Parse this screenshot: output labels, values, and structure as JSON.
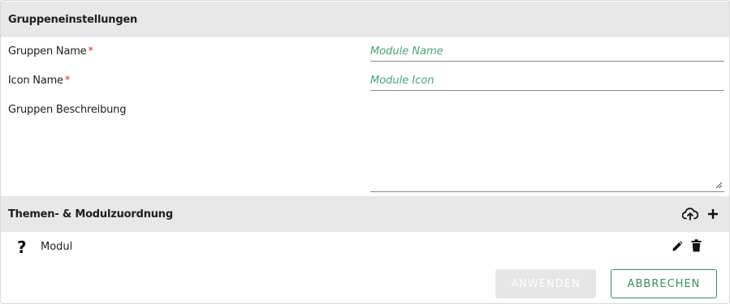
{
  "group_settings": {
    "title": "Gruppeneinstellungen",
    "fields": [
      {
        "label": "Gruppen Name",
        "required_mark": "*",
        "placeholder": "Module Name",
        "value": ""
      },
      {
        "label": "Icon Name",
        "required_mark": "*",
        "placeholder": "Module Icon",
        "value": ""
      }
    ],
    "description": {
      "label": "Gruppen Beschreibung",
      "value": ""
    }
  },
  "assignment": {
    "title": "Themen- & Modulzuordnung",
    "header_icons": [
      "upload-cloud-icon",
      "add-icon"
    ],
    "modules": [
      {
        "icon": "question-mark-icon",
        "icon_glyph": "?",
        "label": "Modul",
        "actions": [
          "edit-icon",
          "delete-icon"
        ]
      }
    ]
  },
  "actions": {
    "apply_label": "ANWENDEN",
    "apply_disabled": true,
    "cancel_label": "ABBRECHEN"
  },
  "colors": {
    "header_bg": "#e8e8e8",
    "accent_green": "#3c8f65",
    "placeholder_green": "#4aa37a",
    "required_red": "#d32f2f",
    "disabled_bg": "#e6e6e6"
  }
}
